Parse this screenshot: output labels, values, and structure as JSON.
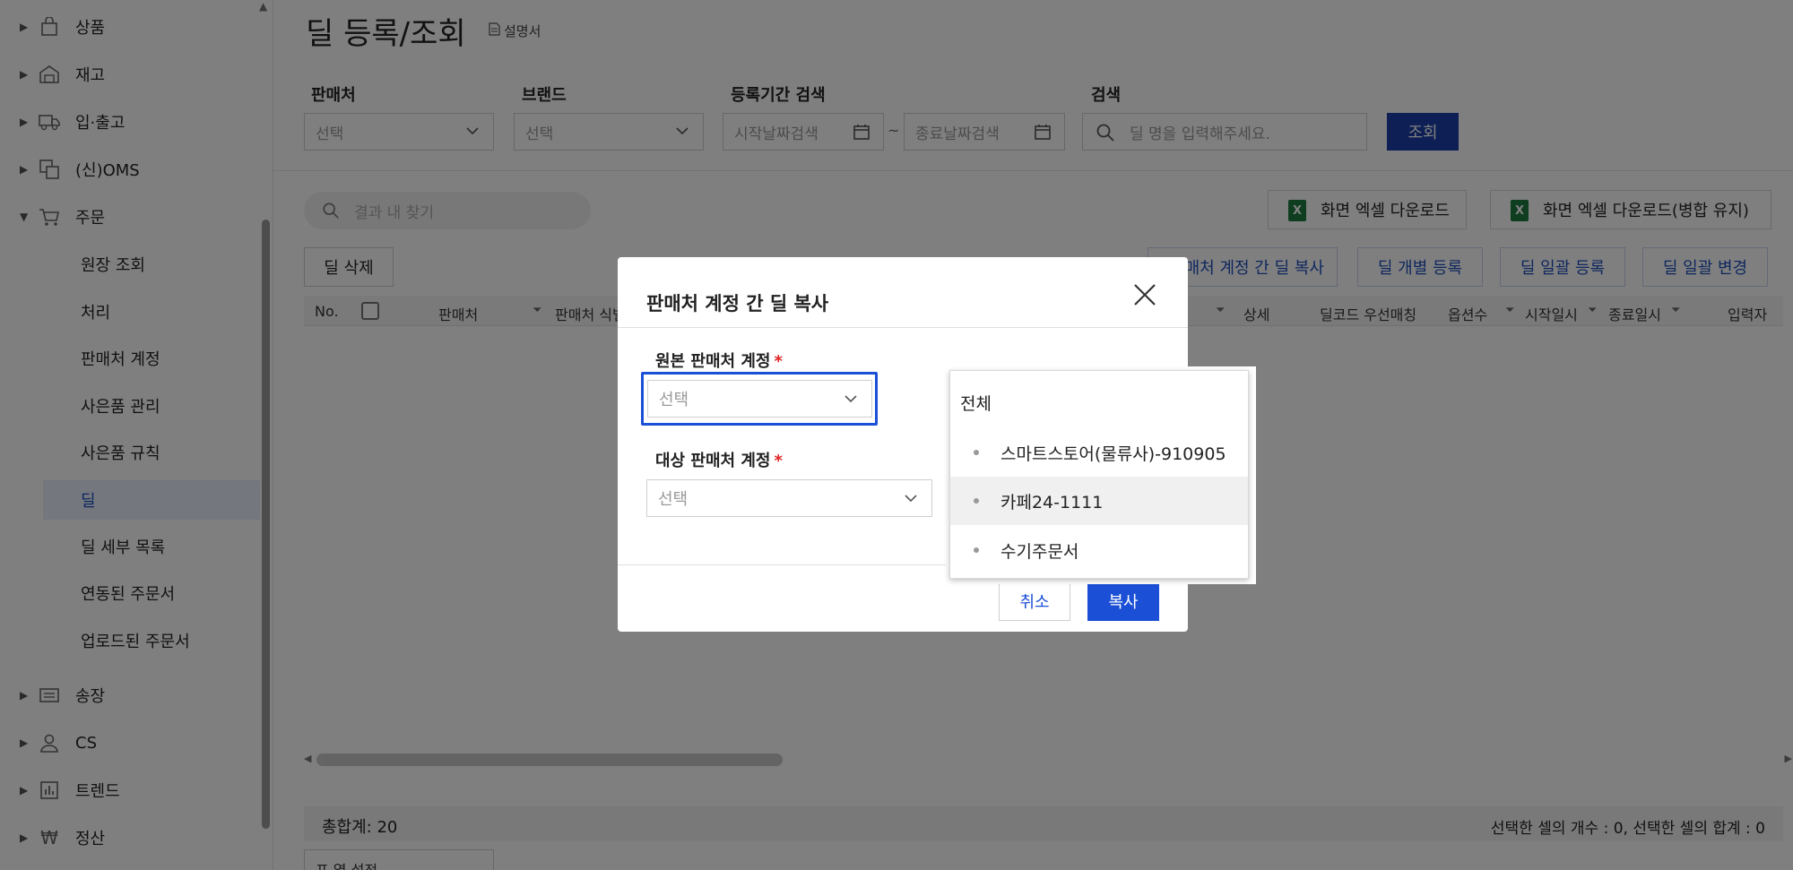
{
  "sidebar": {
    "groups": [
      {
        "label": "상품",
        "icon": "bag-icon"
      },
      {
        "label": "재고",
        "icon": "warehouse-icon"
      },
      {
        "label": "입·출고",
        "icon": "truck-icon"
      },
      {
        "label": "(신)OMS",
        "icon": "oms-icon"
      },
      {
        "label": "주문",
        "icon": "cart-icon"
      }
    ],
    "order_sub_items": [
      "원장 조회",
      "처리",
      "판매처 계정",
      "사은품 관리",
      "사은품 규칙",
      "딜",
      "딜 세부 목록",
      "연동된 주문서",
      "업로드된 주문서"
    ],
    "groups_after": [
      {
        "label": "송장",
        "icon": "invoice-icon"
      },
      {
        "label": "CS",
        "icon": "person-icon"
      },
      {
        "label": "트렌드",
        "icon": "chart-icon"
      },
      {
        "label": "정산",
        "icon": "won-icon"
      }
    ]
  },
  "header": {
    "title": "딜 등록/조회",
    "manual_label": "설명서"
  },
  "filters": {
    "seller_label": "판매처",
    "seller_value": "선택",
    "brand_label": "브랜드",
    "brand_value": "선택",
    "period_label": "등록기간 검색",
    "start_placeholder": "시작날짜검색",
    "tilde": "~",
    "end_placeholder": "종료날짜검색",
    "search_label": "검색",
    "search_placeholder": "딜 명을 입력해주세요.",
    "query_button": "조회"
  },
  "toolbar": {
    "result_search_placeholder": "결과 내 찾기",
    "excel_download": "화면 엑셀 다운로드",
    "excel_download_merged": "화면 엑셀 다운로드(병합 유지)",
    "delete_deal": "딜 삭제",
    "copy_between_accounts": "판매처 계정 간 딜 복사",
    "register_single": "딜 개별 등록",
    "register_bulk": "딜 일괄 등록",
    "change_bulk": "딜 일괄 변경"
  },
  "table": {
    "columns_left": [
      "No.",
      "판매처",
      "판매처 식별"
    ],
    "columns_right": [
      "상세",
      "딜코드 우선매칭",
      "옵션수",
      "시작일시",
      "종료일시",
      "입력자"
    ]
  },
  "footer": {
    "total": "총합계: 20",
    "selection_info": "선택한 셀의 개수 : 0, 선택한 셀의 합계 : 0",
    "column_settings": "표 열 설정"
  },
  "modal": {
    "title": "판매처 계정 간 딜 복사",
    "source_label": "원본 판매처 계정",
    "source_value": "선택",
    "target_label": "대상 판매처 계정",
    "target_value": "선택",
    "required_mark": "*",
    "cancel": "취소",
    "copy": "복사"
  },
  "dropdown": {
    "header": "전체",
    "options": [
      "스마트스토어(물류사)-910905",
      "카페24-1111",
      "수기주문서"
    ],
    "hovered_index": 1
  },
  "colors": {
    "primary": "#1a4fd6",
    "query_button": "#1a3ea8",
    "required": "#e02020",
    "excel": "#1d7a3f"
  }
}
